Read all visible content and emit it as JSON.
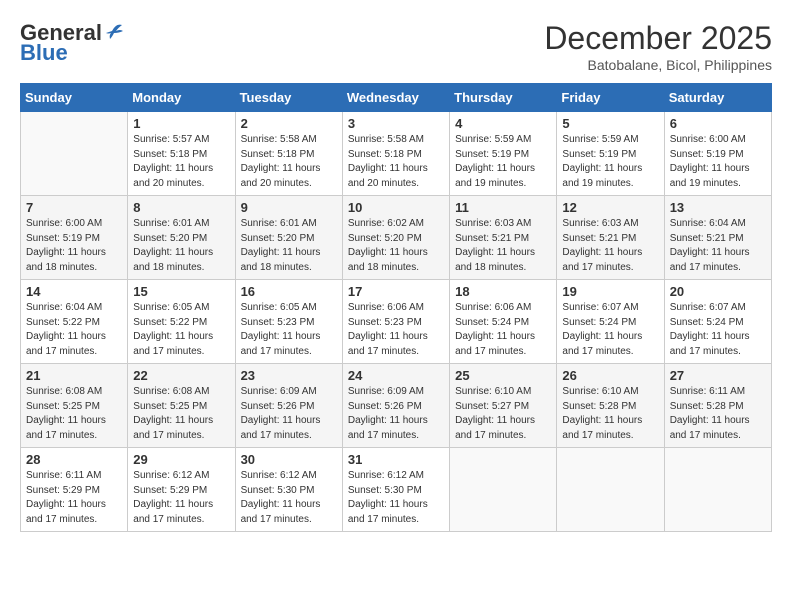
{
  "header": {
    "logo_general": "General",
    "logo_blue": "Blue",
    "month_title": "December 2025",
    "subtitle": "Batobalane, Bicol, Philippines"
  },
  "calendar": {
    "columns": [
      "Sunday",
      "Monday",
      "Tuesday",
      "Wednesday",
      "Thursday",
      "Friday",
      "Saturday"
    ],
    "rows": [
      [
        {
          "day": "",
          "info": ""
        },
        {
          "day": "1",
          "info": "Sunrise: 5:57 AM\nSunset: 5:18 PM\nDaylight: 11 hours\nand 20 minutes."
        },
        {
          "day": "2",
          "info": "Sunrise: 5:58 AM\nSunset: 5:18 PM\nDaylight: 11 hours\nand 20 minutes."
        },
        {
          "day": "3",
          "info": "Sunrise: 5:58 AM\nSunset: 5:18 PM\nDaylight: 11 hours\nand 20 minutes."
        },
        {
          "day": "4",
          "info": "Sunrise: 5:59 AM\nSunset: 5:19 PM\nDaylight: 11 hours\nand 19 minutes."
        },
        {
          "day": "5",
          "info": "Sunrise: 5:59 AM\nSunset: 5:19 PM\nDaylight: 11 hours\nand 19 minutes."
        },
        {
          "day": "6",
          "info": "Sunrise: 6:00 AM\nSunset: 5:19 PM\nDaylight: 11 hours\nand 19 minutes."
        }
      ],
      [
        {
          "day": "7",
          "info": "Sunrise: 6:00 AM\nSunset: 5:19 PM\nDaylight: 11 hours\nand 18 minutes."
        },
        {
          "day": "8",
          "info": "Sunrise: 6:01 AM\nSunset: 5:20 PM\nDaylight: 11 hours\nand 18 minutes."
        },
        {
          "day": "9",
          "info": "Sunrise: 6:01 AM\nSunset: 5:20 PM\nDaylight: 11 hours\nand 18 minutes."
        },
        {
          "day": "10",
          "info": "Sunrise: 6:02 AM\nSunset: 5:20 PM\nDaylight: 11 hours\nand 18 minutes."
        },
        {
          "day": "11",
          "info": "Sunrise: 6:03 AM\nSunset: 5:21 PM\nDaylight: 11 hours\nand 18 minutes."
        },
        {
          "day": "12",
          "info": "Sunrise: 6:03 AM\nSunset: 5:21 PM\nDaylight: 11 hours\nand 17 minutes."
        },
        {
          "day": "13",
          "info": "Sunrise: 6:04 AM\nSunset: 5:21 PM\nDaylight: 11 hours\nand 17 minutes."
        }
      ],
      [
        {
          "day": "14",
          "info": "Sunrise: 6:04 AM\nSunset: 5:22 PM\nDaylight: 11 hours\nand 17 minutes."
        },
        {
          "day": "15",
          "info": "Sunrise: 6:05 AM\nSunset: 5:22 PM\nDaylight: 11 hours\nand 17 minutes."
        },
        {
          "day": "16",
          "info": "Sunrise: 6:05 AM\nSunset: 5:23 PM\nDaylight: 11 hours\nand 17 minutes."
        },
        {
          "day": "17",
          "info": "Sunrise: 6:06 AM\nSunset: 5:23 PM\nDaylight: 11 hours\nand 17 minutes."
        },
        {
          "day": "18",
          "info": "Sunrise: 6:06 AM\nSunset: 5:24 PM\nDaylight: 11 hours\nand 17 minutes."
        },
        {
          "day": "19",
          "info": "Sunrise: 6:07 AM\nSunset: 5:24 PM\nDaylight: 11 hours\nand 17 minutes."
        },
        {
          "day": "20",
          "info": "Sunrise: 6:07 AM\nSunset: 5:24 PM\nDaylight: 11 hours\nand 17 minutes."
        }
      ],
      [
        {
          "day": "21",
          "info": "Sunrise: 6:08 AM\nSunset: 5:25 PM\nDaylight: 11 hours\nand 17 minutes."
        },
        {
          "day": "22",
          "info": "Sunrise: 6:08 AM\nSunset: 5:25 PM\nDaylight: 11 hours\nand 17 minutes."
        },
        {
          "day": "23",
          "info": "Sunrise: 6:09 AM\nSunset: 5:26 PM\nDaylight: 11 hours\nand 17 minutes."
        },
        {
          "day": "24",
          "info": "Sunrise: 6:09 AM\nSunset: 5:26 PM\nDaylight: 11 hours\nand 17 minutes."
        },
        {
          "day": "25",
          "info": "Sunrise: 6:10 AM\nSunset: 5:27 PM\nDaylight: 11 hours\nand 17 minutes."
        },
        {
          "day": "26",
          "info": "Sunrise: 6:10 AM\nSunset: 5:28 PM\nDaylight: 11 hours\nand 17 minutes."
        },
        {
          "day": "27",
          "info": "Sunrise: 6:11 AM\nSunset: 5:28 PM\nDaylight: 11 hours\nand 17 minutes."
        }
      ],
      [
        {
          "day": "28",
          "info": "Sunrise: 6:11 AM\nSunset: 5:29 PM\nDaylight: 11 hours\nand 17 minutes."
        },
        {
          "day": "29",
          "info": "Sunrise: 6:12 AM\nSunset: 5:29 PM\nDaylight: 11 hours\nand 17 minutes."
        },
        {
          "day": "30",
          "info": "Sunrise: 6:12 AM\nSunset: 5:30 PM\nDaylight: 11 hours\nand 17 minutes."
        },
        {
          "day": "31",
          "info": "Sunrise: 6:12 AM\nSunset: 5:30 PM\nDaylight: 11 hours\nand 17 minutes."
        },
        {
          "day": "",
          "info": ""
        },
        {
          "day": "",
          "info": ""
        },
        {
          "day": "",
          "info": ""
        }
      ]
    ]
  }
}
